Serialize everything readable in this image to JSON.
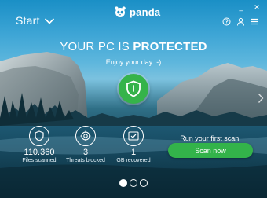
{
  "header": {
    "start_label": "Start",
    "brand_name": "panda",
    "window_controls": {
      "minimize": "_",
      "close": "✕"
    },
    "tool_icons": [
      "help-icon",
      "account-icon",
      "menu-icon"
    ]
  },
  "status": {
    "title_prefix": "YOUR PC IS ",
    "title_state": "PROTECTED",
    "subtitle": "Enjoy your day :-)",
    "accent_color": "#35b34a"
  },
  "stats": [
    {
      "icon": "shield-icon",
      "value": "110.360",
      "label": "Files scanned"
    },
    {
      "icon": "target-icon",
      "value": "3",
      "label": "Threats blocked"
    },
    {
      "icon": "checkmark-icon",
      "value": "1",
      "label": "GB recovered"
    }
  ],
  "scan": {
    "prompt": "Run your first scan!",
    "button_label": "Scan now"
  },
  "pager": {
    "count": 3,
    "active": 0
  }
}
